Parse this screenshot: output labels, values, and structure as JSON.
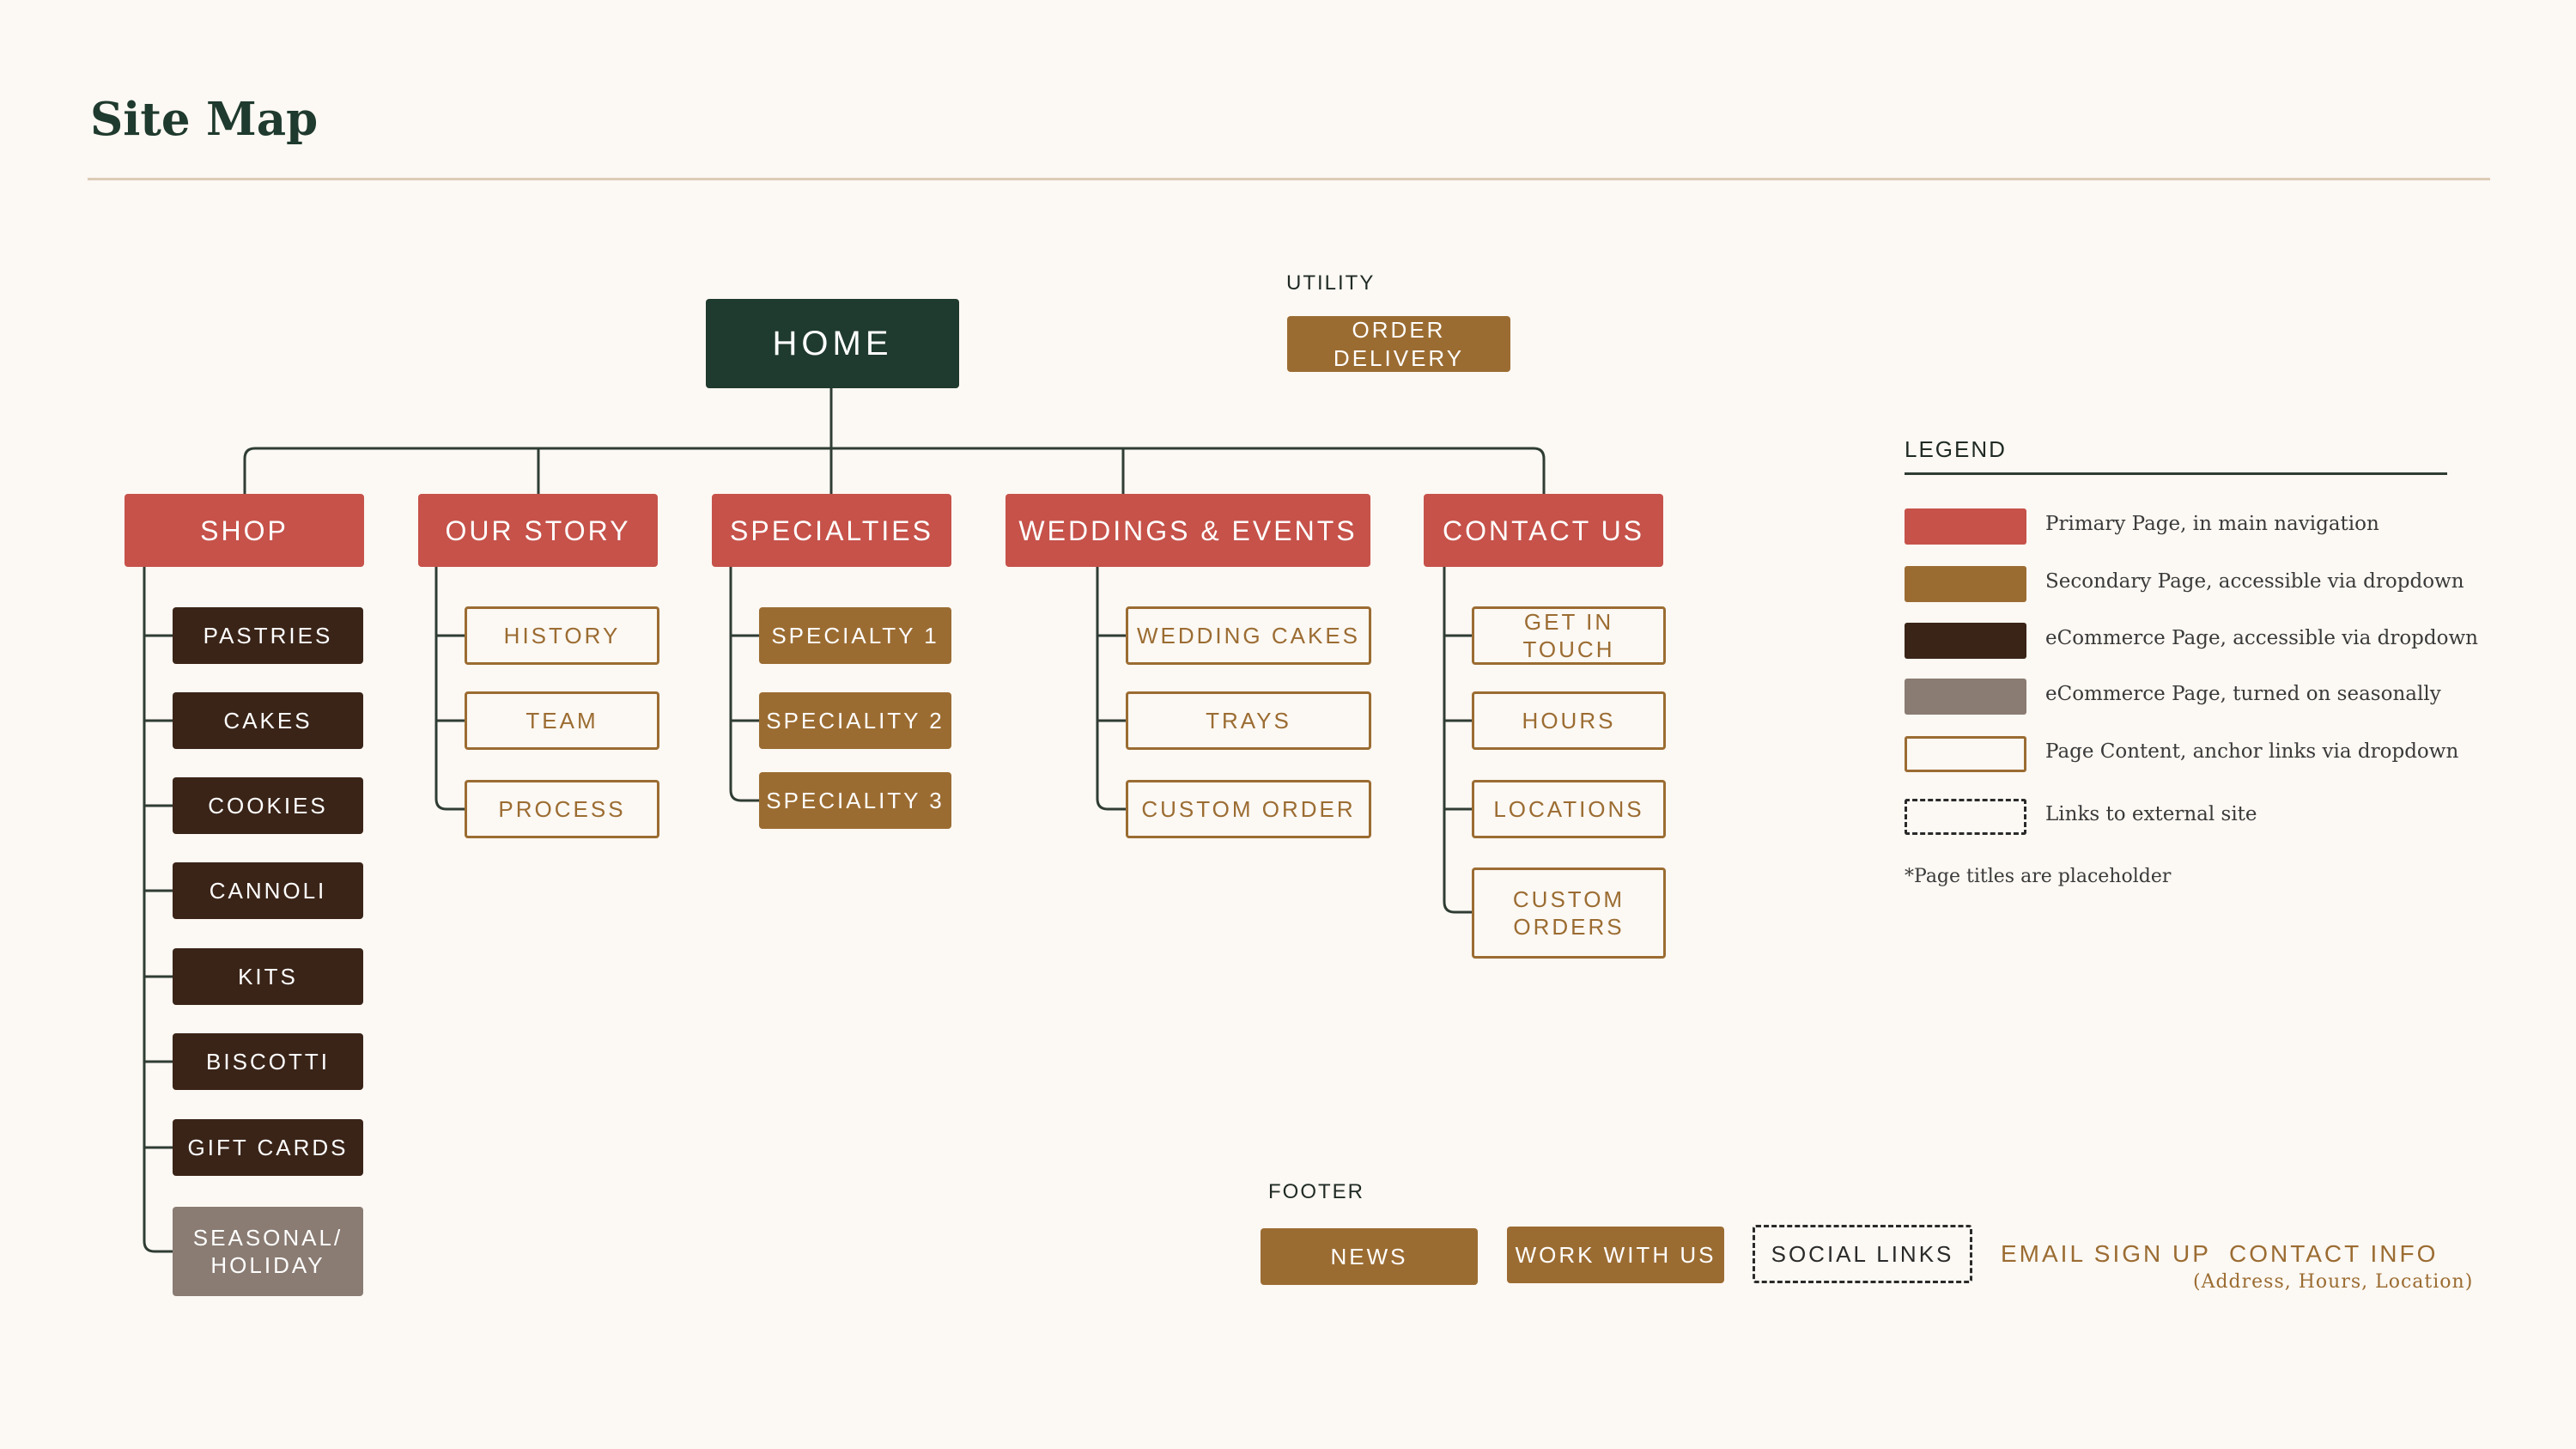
{
  "title": "Site Map",
  "colors": {
    "primary": "#c6524a",
    "secondary": "#9b6c32",
    "ecommerce": "#3a2418",
    "seasonal": "#8a7c73",
    "home": "#1f3a2e",
    "background": "#fcf8f3",
    "connector": "#2f3d34"
  },
  "home": "HOME",
  "utility": {
    "label": "UTILITY",
    "order_delivery": "ORDER DELIVERY"
  },
  "nav": {
    "shop": {
      "label": "SHOP",
      "children": [
        "PASTRIES",
        "CAKES",
        "COOKIES",
        "CANNOLI",
        "KITS",
        "BISCOTTI",
        "GIFT CARDS"
      ],
      "seasonal": [
        "SEASONAL/",
        "HOLIDAY"
      ]
    },
    "our_story": {
      "label": "OUR STORY",
      "children": [
        "HISTORY",
        "TEAM",
        "PROCESS"
      ]
    },
    "specialties": {
      "label": "SPECIALTIES",
      "children": [
        "SPECIALTY 1",
        "SPECIALITY 2",
        "SPECIALITY 3"
      ]
    },
    "weddings": {
      "label": "WEDDINGS & EVENTS",
      "children": [
        "WEDDING CAKES",
        "TRAYS",
        "CUSTOM ORDER"
      ]
    },
    "contact": {
      "label": "CONTACT US",
      "children": [
        "GET IN TOUCH",
        "HOURS",
        "LOCATIONS"
      ],
      "custom_orders": [
        "CUSTOM",
        "ORDERS"
      ]
    }
  },
  "footer": {
    "label": "FOOTER",
    "news": "NEWS",
    "work_with_us": "WORK WITH US",
    "social_links": "SOCIAL LINKS",
    "email_sign_up": "EMAIL SIGN UP",
    "contact_info": "CONTACT INFO",
    "contact_info_sub": "(Address, Hours, Location)"
  },
  "legend": {
    "title": "LEGEND",
    "items": [
      "Primary Page, in main navigation",
      "Secondary Page, accessible via dropdown",
      "eCommerce Page, accessible via dropdown",
      "eCommerce Page, turned on seasonally",
      "Page Content, anchor links via dropdown",
      "Links to external site"
    ],
    "note": "*Page titles are placeholder"
  }
}
